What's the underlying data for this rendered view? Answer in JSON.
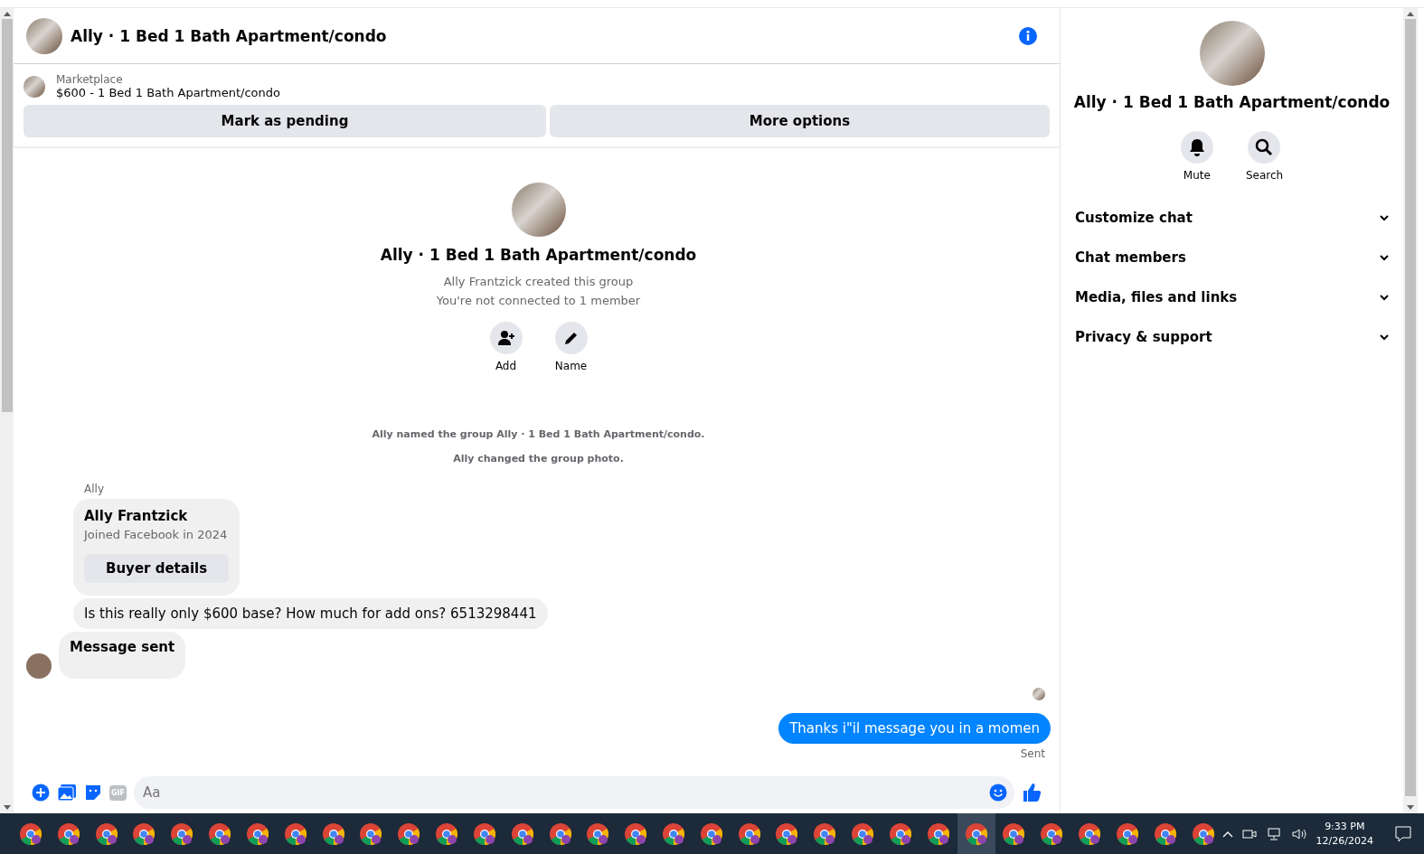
{
  "header": {
    "title": "Ally · 1 Bed 1 Bath Apartment/condo"
  },
  "listing": {
    "source": "Marketplace",
    "title": "$600 - 1 Bed 1 Bath Apartment/condo",
    "buttons": [
      "Mark as pending",
      "More options"
    ]
  },
  "group_intro": {
    "title": "Ally · 1 Bed 1 Bath Apartment/condo",
    "lines": [
      "Ally Frantzick created this group",
      "You're not connected to 1 member"
    ],
    "actions": [
      "Add",
      "Name"
    ]
  },
  "events": [
    "Ally named the group Ally · 1 Bed 1 Bath Apartment/condo.",
    "Ally changed the group photo."
  ],
  "messages": [
    {
      "kind": "sender",
      "text": "Ally"
    },
    {
      "kind": "profile_card",
      "name": "Ally Frantzick",
      "detail": "Joined Facebook in 2024",
      "button": "Buyer details"
    },
    {
      "kind": "incoming",
      "text": "Is this really only $600 base? How much for add ons? 6513298441"
    },
    {
      "kind": "incoming_last",
      "text": "Message sent"
    },
    {
      "kind": "outgoing",
      "text": "Thanks i\"il message you in a momen",
      "status": "Sent"
    }
  ],
  "composer": {
    "gif_label": "GIF",
    "placeholder": "Aa"
  },
  "side_panel": {
    "title": "Ally · 1 Bed 1 Bath Apartment/condo",
    "actions": [
      "Mute",
      "Search"
    ],
    "sections": [
      {
        "label": "Customize chat",
        "expanded": false
      },
      {
        "label": "Chat members",
        "expanded": false
      },
      {
        "label": "Media, files and links",
        "expanded": false
      },
      {
        "label": "Privacy & support",
        "expanded": false
      }
    ]
  },
  "taskbar": {
    "apps": [
      {
        "selected": false
      },
      {
        "selected": false
      },
      {
        "selected": false
      },
      {
        "selected": false
      },
      {
        "selected": false
      },
      {
        "selected": false
      },
      {
        "selected": false
      },
      {
        "selected": false
      },
      {
        "selected": false
      },
      {
        "selected": false
      },
      {
        "selected": false
      },
      {
        "selected": false
      },
      {
        "selected": false
      },
      {
        "selected": false
      },
      {
        "selected": false
      },
      {
        "selected": false
      },
      {
        "selected": false
      },
      {
        "selected": false
      },
      {
        "selected": false
      },
      {
        "selected": false
      },
      {
        "selected": false
      },
      {
        "selected": false
      },
      {
        "selected": false
      },
      {
        "selected": false
      },
      {
        "selected": false
      },
      {
        "selected": true
      },
      {
        "selected": false
      },
      {
        "selected": false
      },
      {
        "selected": false
      },
      {
        "selected": false
      },
      {
        "selected": false
      },
      {
        "selected": false
      }
    ],
    "time": "9:33 PM",
    "date": "12/26/2024"
  }
}
